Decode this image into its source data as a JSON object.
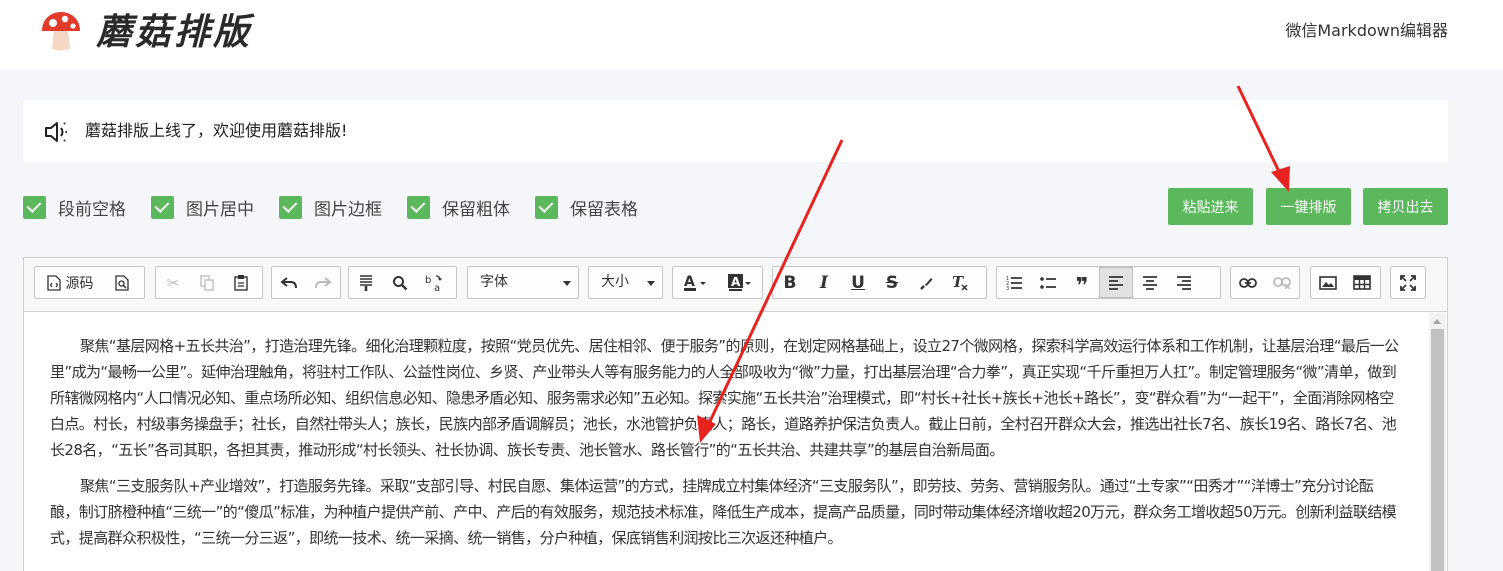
{
  "header": {
    "logo_text": "蘑菇排版",
    "subtitle": "微信Markdown编辑器"
  },
  "notice": {
    "text": "蘑菇排版上线了，欢迎使用蘑菇排版!"
  },
  "options": [
    {
      "label": "段前空格",
      "checked": true
    },
    {
      "label": "图片居中",
      "checked": true
    },
    {
      "label": "图片边框",
      "checked": true
    },
    {
      "label": "保留粗体",
      "checked": true
    },
    {
      "label": "保留表格",
      "checked": true
    }
  ],
  "actions": {
    "paste": "粘贴进来",
    "format": "一键排版",
    "copy": "拷贝出去"
  },
  "toolbar": {
    "source": "源码",
    "font": "字体",
    "size": "大小"
  },
  "content": {
    "paragraphs": [
      "聚焦“基层网格+五长共治”，打造治理先锋。细化治理颗粒度，按照“党员优先、居住相邻、便于服务”的原则，在划定网格基础上，设立27个微网格，探索科学高效运行体系和工作机制，让基层治理“最后一公里”成为“最畅一公里”。延伸治理触角，将驻村工作队、公益性岗位、乡贤、产业带头人等有服务能力的人全部吸收为“微”力量，打出基层治理“合力拳”，真正实现“千斤重担万人扛”。制定管理服务“微”清单，做到所辖微网格内“人口情况必知、重点场所必知、组织信息必知、隐患矛盾必知、服务需求必知”五必知。探索实施“五长共治”治理模式，即“村长+社长+族长+池长+路长”，变“群众看”为“一起干”，全面消除网格空白点。村长，村级事务操盘手；社长，自然社带头人；族长，民族内部矛盾调解员；池长，水池管护负责人；路长，道路养护保洁负责人。截止日前，全村召开群众大会，推选出社长7名、族长19名、路长7名、池长28名，“五长”各司其职，各担其责，推动形成“村长领头、社长协调、族长专责、池长管水、路长管行”的“五长共治、共建共享”的基层自治新局面。",
      "聚焦“三支服务队+产业增效”，打造服务先锋。采取“支部引导、村民自愿、集体运营”的方式，挂牌成立村集体经济“三支服务队”，即劳技、劳务、营销服务队。通过“土专家”“田秀才”“洋博士”充分讨论酝酿，制订脐橙种植“三统一”的“傻瓜”标准，为种植户提供产前、产中、产后的有效服务，规范技术标准，降低生产成本，提高产品质量，同时带动集体经济增收超20万元，群众务工增收超50万元。创新利益联结模式，提高群众积极性，“三统一分三返”，即统一技术、统一采摘、统一销售，分户种植，保底销售利润按比三次返还种植户。"
    ]
  },
  "colors": {
    "accent_green": "#5cb85c",
    "annotation_red": "#e8231f"
  }
}
